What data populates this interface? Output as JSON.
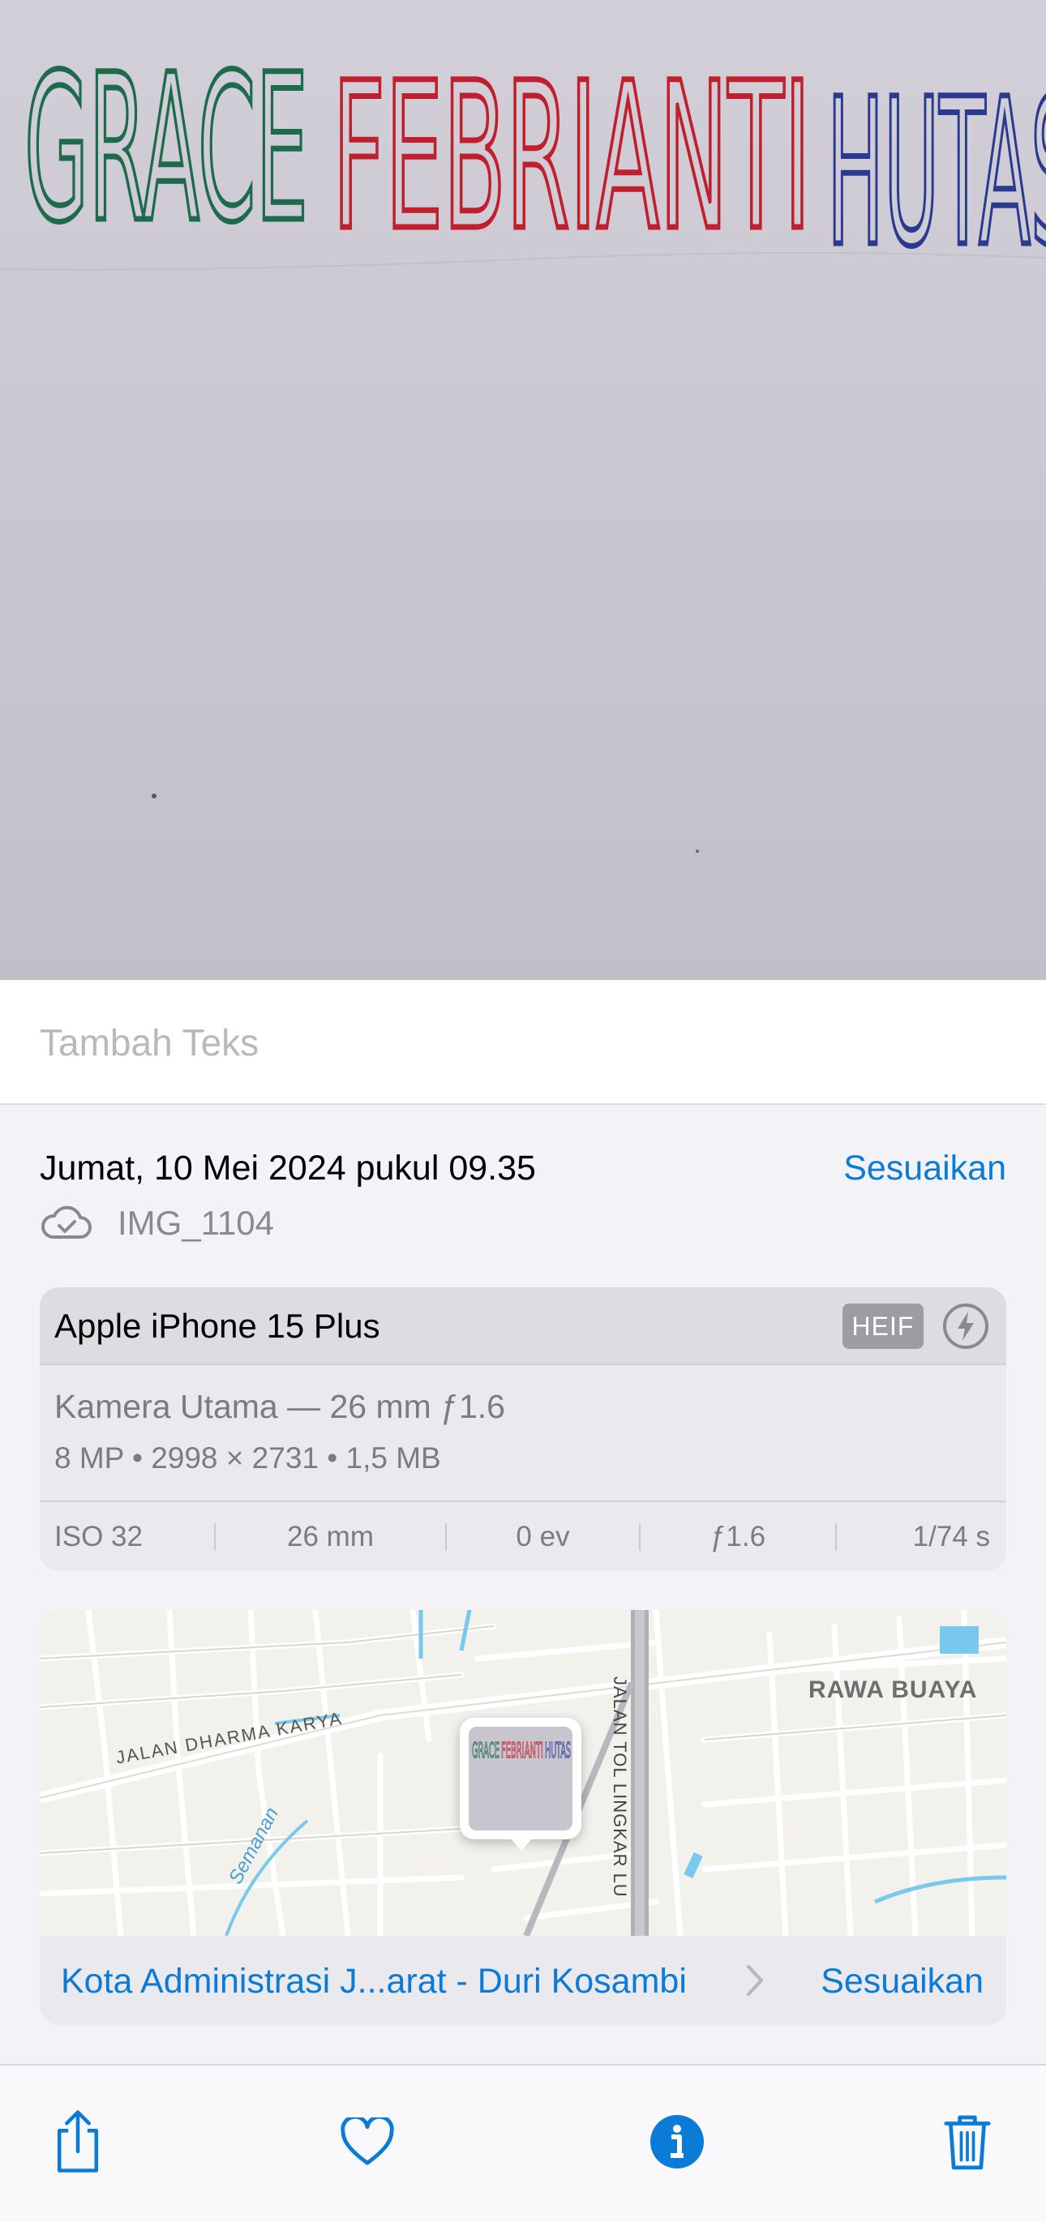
{
  "photo": {
    "handwriting": {
      "green": "GRACE",
      "red": "FEBRIANTI",
      "blue": "HUTAS"
    },
    "colors": {
      "green": "#1d6b4a",
      "red": "#c0202e",
      "blue": "#2a3a8e"
    }
  },
  "caption": {
    "placeholder": "Tambah Teks"
  },
  "info": {
    "date": "Jumat, 10 Mei 2024 pukul 09.35",
    "adjust_label": "Sesuaikan",
    "file_name": "IMG_1104",
    "cloud_icon": "cloud-check-icon"
  },
  "device": {
    "name": "Apple iPhone 15 Plus",
    "format_badge": "HEIF",
    "flash_icon": "flash-icon",
    "lens": "Kamera Utama — 26 mm ƒ1.6",
    "specs": "8 MP  •  2998 × 2731  •  1,5 MB",
    "exif": [
      {
        "label": "ISO 32"
      },
      {
        "label": "26 mm"
      },
      {
        "label": "0 ev"
      },
      {
        "label": "ƒ1.6"
      },
      {
        "label": "1/74 s"
      }
    ]
  },
  "map": {
    "labels": {
      "area": "RAWA BUAYA",
      "road_main": "JALAN DHARMA KARYA",
      "road_toll": "JALAN TOL LINGKAR LU",
      "river": "Semanan"
    },
    "location": "Kota Administrasi J...arat - Duri Kosambi",
    "adjust_label": "Sesuaikan"
  },
  "toolbar": {
    "share": "share-icon",
    "favorite": "heart-icon",
    "info": "info-icon",
    "delete": "trash-icon"
  },
  "accent": "#0a7bd6"
}
